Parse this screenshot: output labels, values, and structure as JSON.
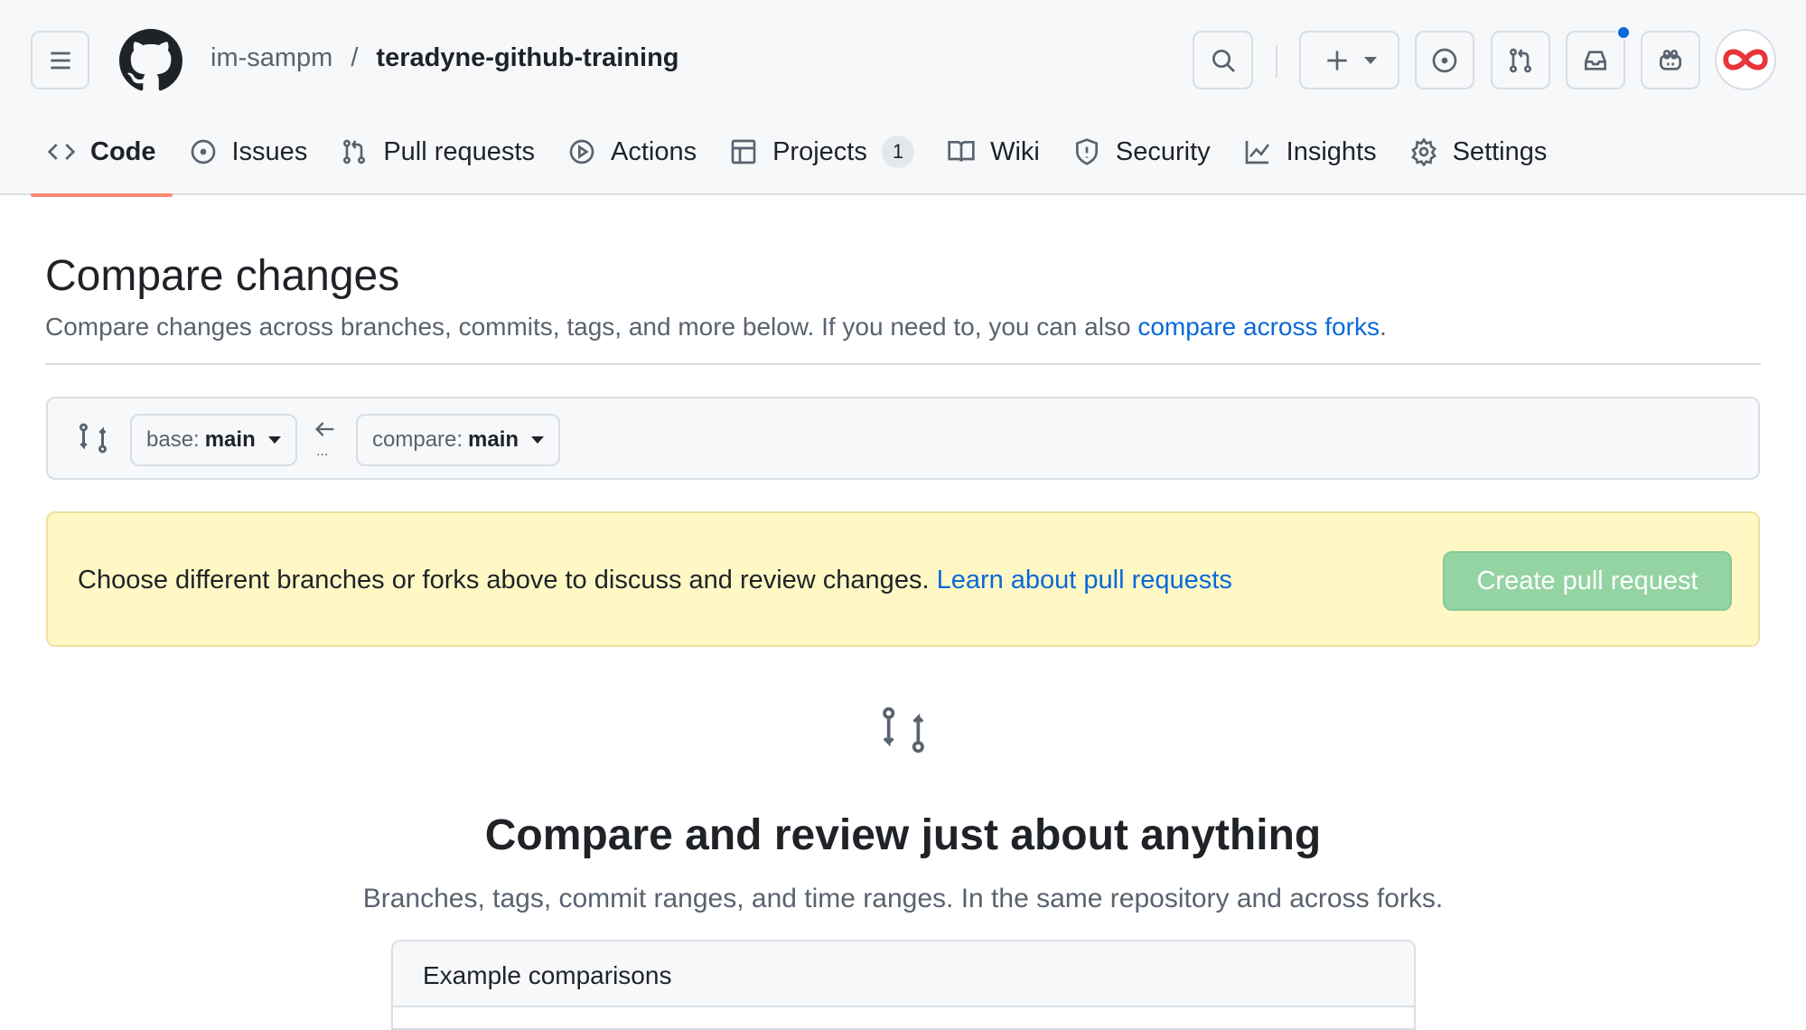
{
  "header": {
    "owner": "im-sampm",
    "separator": "/",
    "repo": "teradyne-github-training",
    "notification_dot_color": "#0969da"
  },
  "tabs": [
    {
      "label": "Code",
      "icon": "code-icon"
    },
    {
      "label": "Issues",
      "icon": "issue-icon"
    },
    {
      "label": "Pull requests",
      "icon": "pull-request-icon"
    },
    {
      "label": "Actions",
      "icon": "play-icon"
    },
    {
      "label": "Projects",
      "icon": "table-icon",
      "count": "1"
    },
    {
      "label": "Wiki",
      "icon": "book-icon"
    },
    {
      "label": "Security",
      "icon": "shield-icon"
    },
    {
      "label": "Insights",
      "icon": "graph-icon"
    },
    {
      "label": "Settings",
      "icon": "gear-icon"
    }
  ],
  "page": {
    "title": "Compare changes",
    "subtitle": "Compare changes across branches, commits, tags, and more below. If you need to, you can also ",
    "subtitle_link": "compare across forks",
    "subtitle_end": "."
  },
  "compare": {
    "base_prefix": "base:",
    "base_branch": "main",
    "compare_prefix": "compare:",
    "compare_branch": "main",
    "dots": "..."
  },
  "flash": {
    "message": "Choose different branches or forks above to discuss and review changes. ",
    "link": "Learn about pull requests",
    "button": "Create pull request"
  },
  "blank": {
    "heading": "Compare and review just about anything",
    "text": "Branches, tags, commit ranges, and time ranges. In the same repository and across forks.",
    "examples_title": "Example comparisons"
  }
}
